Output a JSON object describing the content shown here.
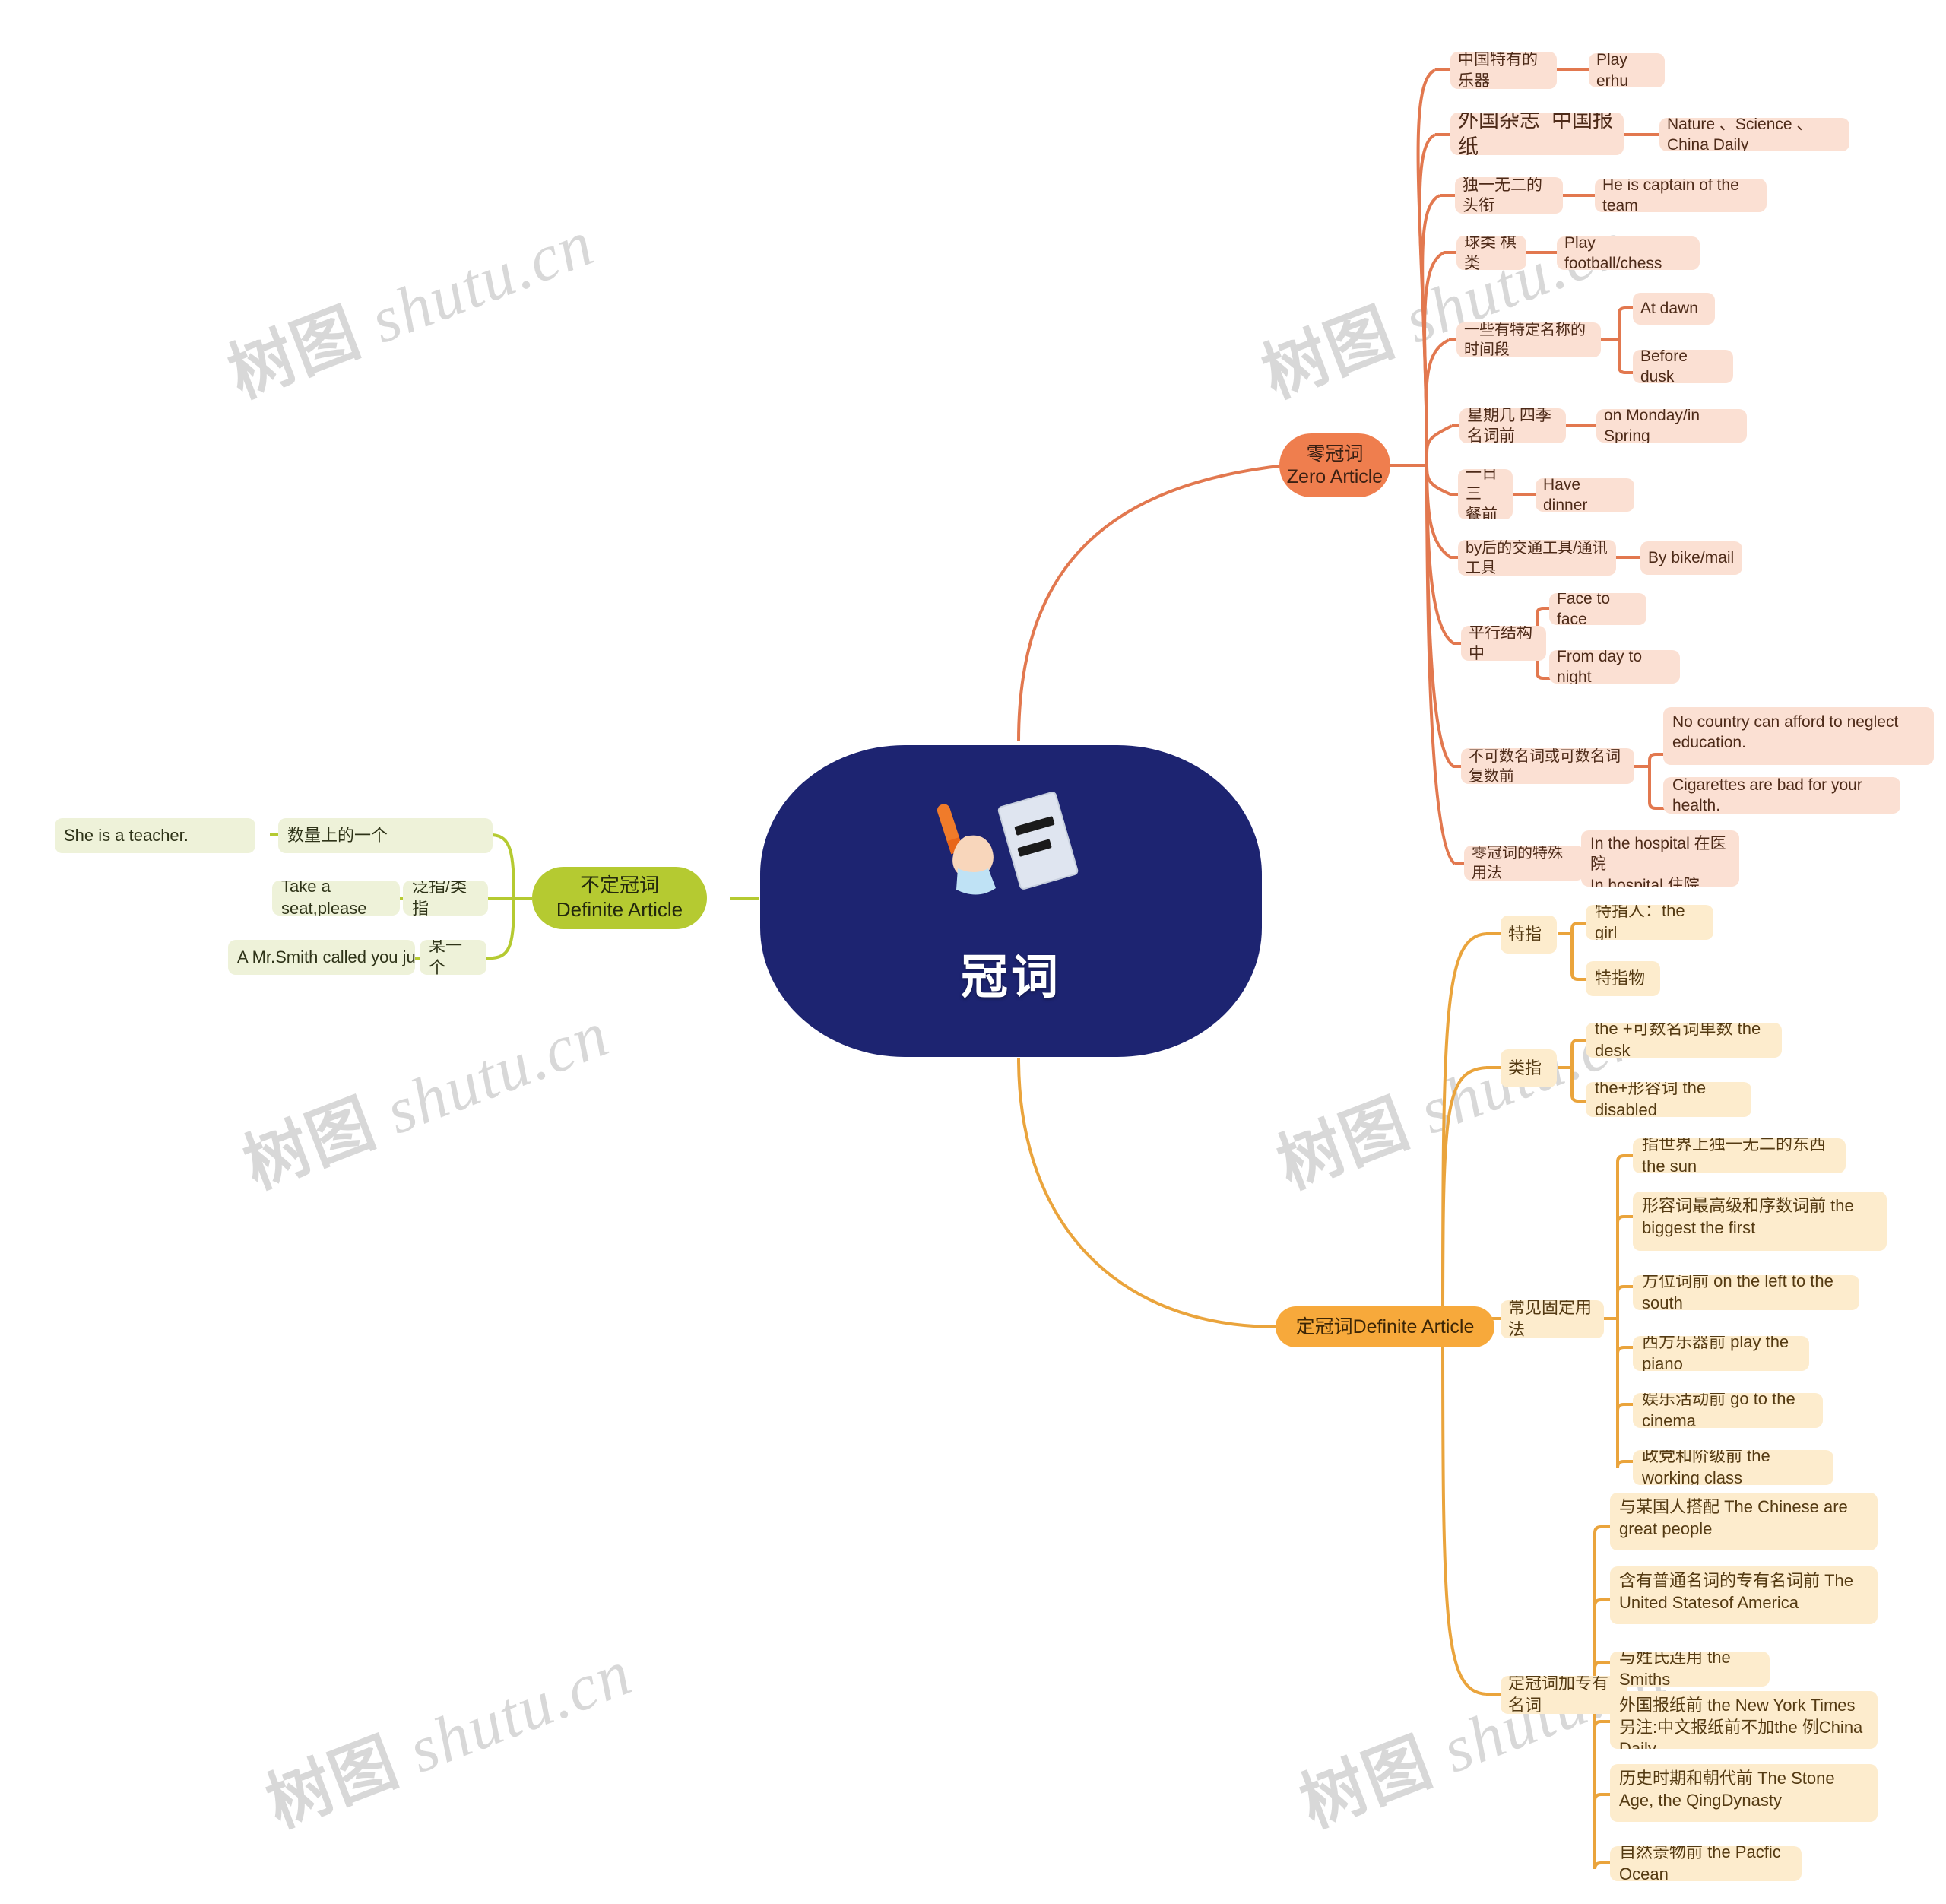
{
  "meta": {
    "watermark_text": "树图 shutu.cn",
    "colors": {
      "root_bg": "#1d2471",
      "zero_pill": "#ef7e4e",
      "zero_box": "#fbe0d3",
      "zero_line": "#e2784f",
      "indefinite_pill": "#b5ca31",
      "indefinite_box": "#eef2d9",
      "indefinite_line": "#b5ca31",
      "definite_pill": "#f7a93b",
      "definite_box": "#fdeccd",
      "definite_line": "#eaa43c"
    }
  },
  "root": {
    "label": "冠词",
    "icon": "writing-hand-icon"
  },
  "branches": {
    "zero": {
      "pill_line1": "零冠词",
      "pill_line2": "Zero Article",
      "items": [
        {
          "label": "中国特有的乐器",
          "children": [
            "Play erhu"
          ]
        },
        {
          "label": "外国杂志  中国报纸",
          "children": [
            "Nature 、Science 、China Daily"
          ]
        },
        {
          "label": "独一无二的头衔",
          "children": [
            "He is captain of the team"
          ]
        },
        {
          "label": "球类 棋类",
          "children": [
            "Play football/chess"
          ]
        },
        {
          "label": "一些有特定名称的时间段",
          "children": [
            "At dawn",
            "Before dusk"
          ]
        },
        {
          "label": "星期几 四季名词前",
          "children": [
            "on Monday/in Spring"
          ]
        },
        {
          "label": "一日三\n餐前",
          "children": [
            "Have dinner"
          ]
        },
        {
          "label": "by后的交通工具/通讯工具",
          "children": [
            "By bike/mail"
          ]
        },
        {
          "label": "平行结构中",
          "children": [
            "Face to face",
            "From day to night"
          ]
        },
        {
          "label": "不可数名词或可数名词复数前",
          "children": [
            "No country can afford to neglect education.",
            "Cigarettes are bad for your health."
          ]
        },
        {
          "label": "零冠词的特殊用法",
          "children": [
            "In the hospital 在医院\nIn hospital 住院"
          ]
        }
      ]
    },
    "indefinite": {
      "pill_line1": "不定冠词",
      "pill_line2": "Definite Article",
      "items": [
        {
          "label": "数量上的一个",
          "children": [
            "She is a teacher."
          ]
        },
        {
          "label": "泛指/类指",
          "children": [
            "Take a seat,please"
          ]
        },
        {
          "label": "某一个",
          "children": [
            "A Mr.Smith called you just now."
          ]
        }
      ]
    },
    "definite": {
      "pill_label": "定冠词Definite  Article",
      "items": [
        {
          "label": "特指",
          "children": [
            "特指人：the girl",
            "特指物"
          ]
        },
        {
          "label": "类指",
          "children": [
            "the +可数名词单数 the desk",
            "the+形容词 the disabled"
          ]
        },
        {
          "label": "常见固定用法",
          "children": [
            "指世界上独一无二的东西 the sun",
            "形容词最高级和序数词前 the biggest the first",
            "方位词前 on the left to the south",
            "西方乐器前 play the piano",
            "娱乐活动前 go to the cinema",
            "政党和阶级前 the working class"
          ]
        },
        {
          "label": "定冠词加专有名词",
          "children": [
            "与某国人搭配 The Chinese are great people",
            "含有普通名词的专有名词前 The United Statesof America",
            "与姓氏连用 the Smiths",
            "外国报纸前 the New York Times 另注:中文报纸前不加the 例China Daily",
            "历史时期和朝代前 The Stone Age, the QingDynasty",
            "自然景物前 the Pacfic Ocean"
          ]
        }
      ]
    }
  }
}
